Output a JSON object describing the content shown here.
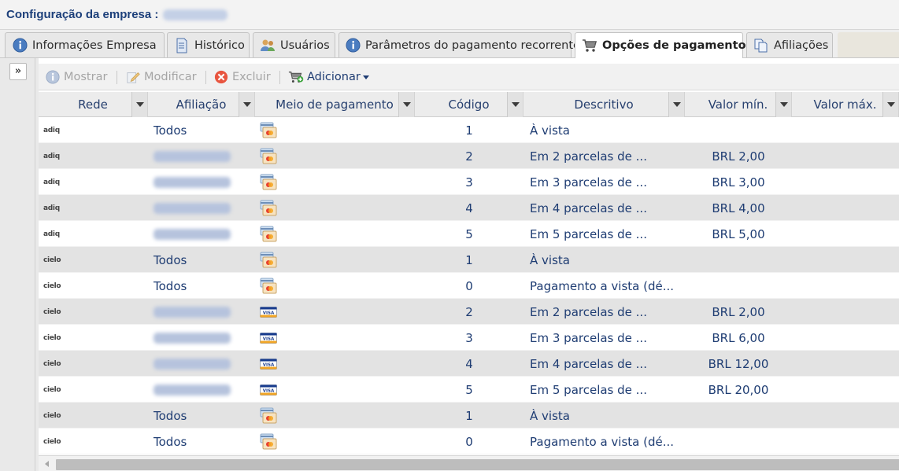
{
  "header": {
    "title": "Configuração da empresa :"
  },
  "tabs": [
    {
      "label": "Informações Empresa",
      "icon": "info-icon"
    },
    {
      "label": "Histórico",
      "icon": "document-icon"
    },
    {
      "label": "Usuários",
      "icon": "users-icon"
    },
    {
      "label": "Parâmetros do pagamento recorrente",
      "icon": "info-icon"
    },
    {
      "label": "Opções de pagamento",
      "icon": "cart-icon",
      "active": true
    },
    {
      "label": "Afiliações",
      "icon": "documents-icon"
    }
  ],
  "toolbar": {
    "show_label": "Mostrar",
    "modify_label": "Modificar",
    "delete_label": "Excluir",
    "add_label": "Adicionar"
  },
  "expand_label": "»",
  "columns": [
    "Rede",
    "Afiliação",
    "Meio de pagamento",
    "Código",
    "Descritivo",
    "Valor mín.",
    "Valor máx."
  ],
  "rows": [
    {
      "network": "adiq",
      "affiliation": "Todos",
      "payment": "multi",
      "code": "1",
      "description": "À vista",
      "min": "",
      "max": ""
    },
    {
      "network": "adiq",
      "affiliation": "",
      "payment": "multi",
      "code": "2",
      "description": "Em 2 parcelas de ...",
      "min": "BRL 2,00",
      "max": ""
    },
    {
      "network": "adiq",
      "affiliation": "",
      "payment": "multi",
      "code": "3",
      "description": "Em 3 parcelas de ...",
      "min": "BRL 3,00",
      "max": ""
    },
    {
      "network": "adiq",
      "affiliation": "",
      "payment": "multi",
      "code": "4",
      "description": "Em 4 parcelas de ...",
      "min": "BRL 4,00",
      "max": ""
    },
    {
      "network": "adiq",
      "affiliation": "",
      "payment": "multi",
      "code": "5",
      "description": "Em 5 parcelas de ...",
      "min": "BRL 5,00",
      "max": ""
    },
    {
      "network": "cielo",
      "affiliation": "Todos",
      "payment": "multi",
      "code": "1",
      "description": "À vista",
      "min": "",
      "max": ""
    },
    {
      "network": "cielo",
      "affiliation": "Todos",
      "payment": "multi",
      "code": "0",
      "description": "Pagamento a vista (dé...",
      "min": "",
      "max": ""
    },
    {
      "network": "cielo",
      "affiliation": "",
      "payment": "visa",
      "code": "2",
      "description": "Em 2 parcelas de ...",
      "min": "BRL 2,00",
      "max": ""
    },
    {
      "network": "cielo",
      "affiliation": "",
      "payment": "visa",
      "code": "3",
      "description": "Em 3 parcelas de ...",
      "min": "BRL 6,00",
      "max": ""
    },
    {
      "network": "cielo",
      "affiliation": "",
      "payment": "visa",
      "code": "4",
      "description": "Em 4 parcelas de ...",
      "min": "BRL 12,00",
      "max": ""
    },
    {
      "network": "cielo",
      "affiliation": "",
      "payment": "visa",
      "code": "5",
      "description": "Em 5 parcelas de ...",
      "min": "BRL 20,00",
      "max": ""
    },
    {
      "network": "cielo",
      "affiliation": "Todos",
      "payment": "multi",
      "code": "1",
      "description": "À vista",
      "min": "",
      "max": ""
    },
    {
      "network": "cielo",
      "affiliation": "Todos",
      "payment": "multi",
      "code": "0",
      "description": "Pagamento a vista (dé...",
      "min": "",
      "max": ""
    }
  ],
  "colors": {
    "accent_text": "#1f3d73",
    "row_alt_bg": "#e3e3e3",
    "delete_red": "#e04a3a"
  }
}
